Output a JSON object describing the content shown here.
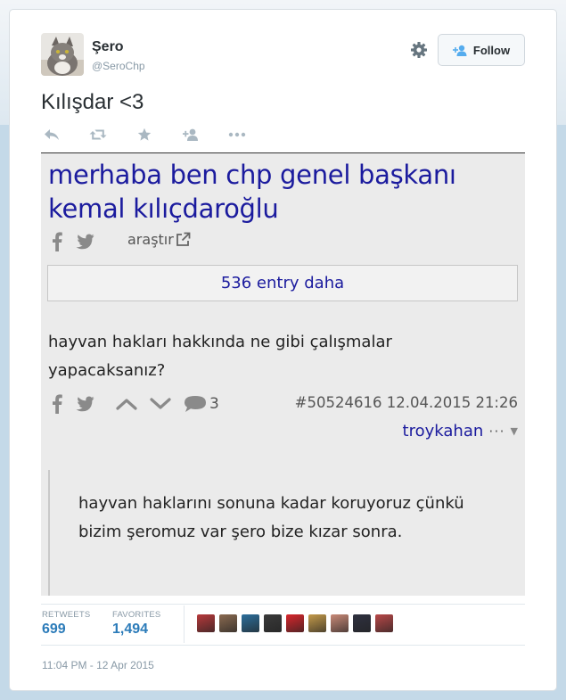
{
  "tweet": {
    "author_name": "Şero",
    "author_handle": "@SeroChp",
    "follow_label": "Follow",
    "text": "Kılışdar <3",
    "retweets_label": "RETWEETS",
    "retweets_count": "699",
    "favorites_label": "FAVORITES",
    "favorites_count": "1,494",
    "timestamp": "11:04 PM - 12 Apr 2015",
    "action_icons": [
      "reply-icon",
      "retweet-icon",
      "favorite-star-icon",
      "follow-user-icon",
      "more-dots-icon"
    ],
    "favoriter_avatar_colors": [
      "#b7393b",
      "#8a6a50",
      "#2c6f9c",
      "#3a3a3a",
      "#d8262c",
      "#c39a4a",
      "#c98a78",
      "#2f3140",
      "#b84848"
    ]
  },
  "embedded_page": {
    "title": "merhaba ben chp genel başkanı kemal kılıçdaroğlu",
    "search_label": "araştır",
    "more_entries_label": "536 entry daha",
    "entry_text": "hayvan hakları hakkında ne gibi çalışmalar yapacaksanız?",
    "comment_count": "3",
    "entry_meta": "#50524616 12.04.2015 21:26",
    "entry_author": "troykahan",
    "entry_author_menu": "···",
    "quote_text": "hayvan haklarını sonuna kadar koruyoruz çünkü bizim şeromuz var şero bize kızar sonra.",
    "link_color": "#1b1b9e"
  },
  "colors": {
    "accent": "#2b7bb9",
    "muted": "#8899a6",
    "text": "#292f33"
  }
}
